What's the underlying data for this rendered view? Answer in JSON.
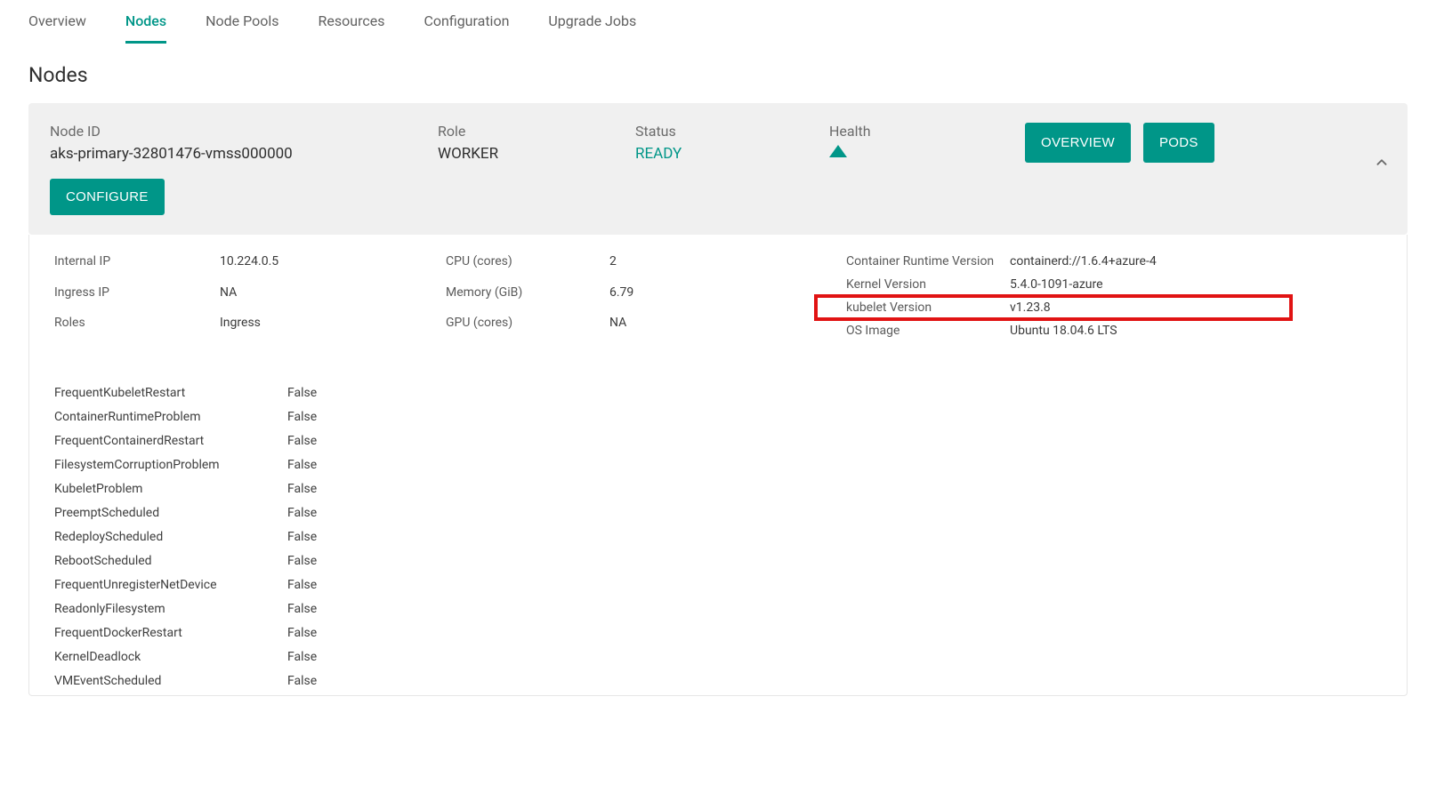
{
  "tabs": [
    {
      "label": "Overview",
      "active": false
    },
    {
      "label": "Nodes",
      "active": true
    },
    {
      "label": "Node Pools",
      "active": false
    },
    {
      "label": "Resources",
      "active": false
    },
    {
      "label": "Configuration",
      "active": false
    },
    {
      "label": "Upgrade Jobs",
      "active": false
    }
  ],
  "page_title": "Nodes",
  "node_header": {
    "node_id_label": "Node ID",
    "node_id": "aks-primary-32801476-vmss000000",
    "role_label": "Role",
    "role": "WORKER",
    "status_label": "Status",
    "status": "READY",
    "health_label": "Health",
    "buttons": {
      "overview": "OVERVIEW",
      "pods": "PODS",
      "configure": "CONFIGURE"
    }
  },
  "details": {
    "left": [
      {
        "k": "Internal IP",
        "v": "10.224.0.5"
      },
      {
        "k": "Ingress IP",
        "v": "NA"
      },
      {
        "k": "Roles",
        "v": "Ingress"
      }
    ],
    "mid": [
      {
        "k": "CPU (cores)",
        "v": "2"
      },
      {
        "k": "Memory (GiB)",
        "v": "6.79"
      },
      {
        "k": "GPU (cores)",
        "v": "NA"
      }
    ],
    "right": [
      {
        "k": "Container Runtime Version",
        "v": "containerd://1.6.4+azure-4",
        "highlight": false
      },
      {
        "k": "Kernel Version",
        "v": "5.4.0-1091-azure",
        "highlight": false
      },
      {
        "k": "kubelet Version",
        "v": "v1.23.8",
        "highlight": true
      },
      {
        "k": "OS Image",
        "v": "Ubuntu 18.04.6 LTS",
        "highlight": false
      }
    ]
  },
  "health_checks": [
    {
      "k": "FrequentKubeletRestart",
      "v": "False"
    },
    {
      "k": "ContainerRuntimeProblem",
      "v": "False"
    },
    {
      "k": "FrequentContainerdRestart",
      "v": "False"
    },
    {
      "k": "FilesystemCorruptionProblem",
      "v": "False"
    },
    {
      "k": "KubeletProblem",
      "v": "False"
    },
    {
      "k": "PreemptScheduled",
      "v": "False"
    },
    {
      "k": "RedeployScheduled",
      "v": "False"
    },
    {
      "k": "RebootScheduled",
      "v": "False"
    },
    {
      "k": "FrequentUnregisterNetDevice",
      "v": "False"
    },
    {
      "k": "ReadonlyFilesystem",
      "v": "False"
    },
    {
      "k": "FrequentDockerRestart",
      "v": "False"
    },
    {
      "k": "KernelDeadlock",
      "v": "False"
    },
    {
      "k": "VMEventScheduled",
      "v": "False"
    }
  ]
}
